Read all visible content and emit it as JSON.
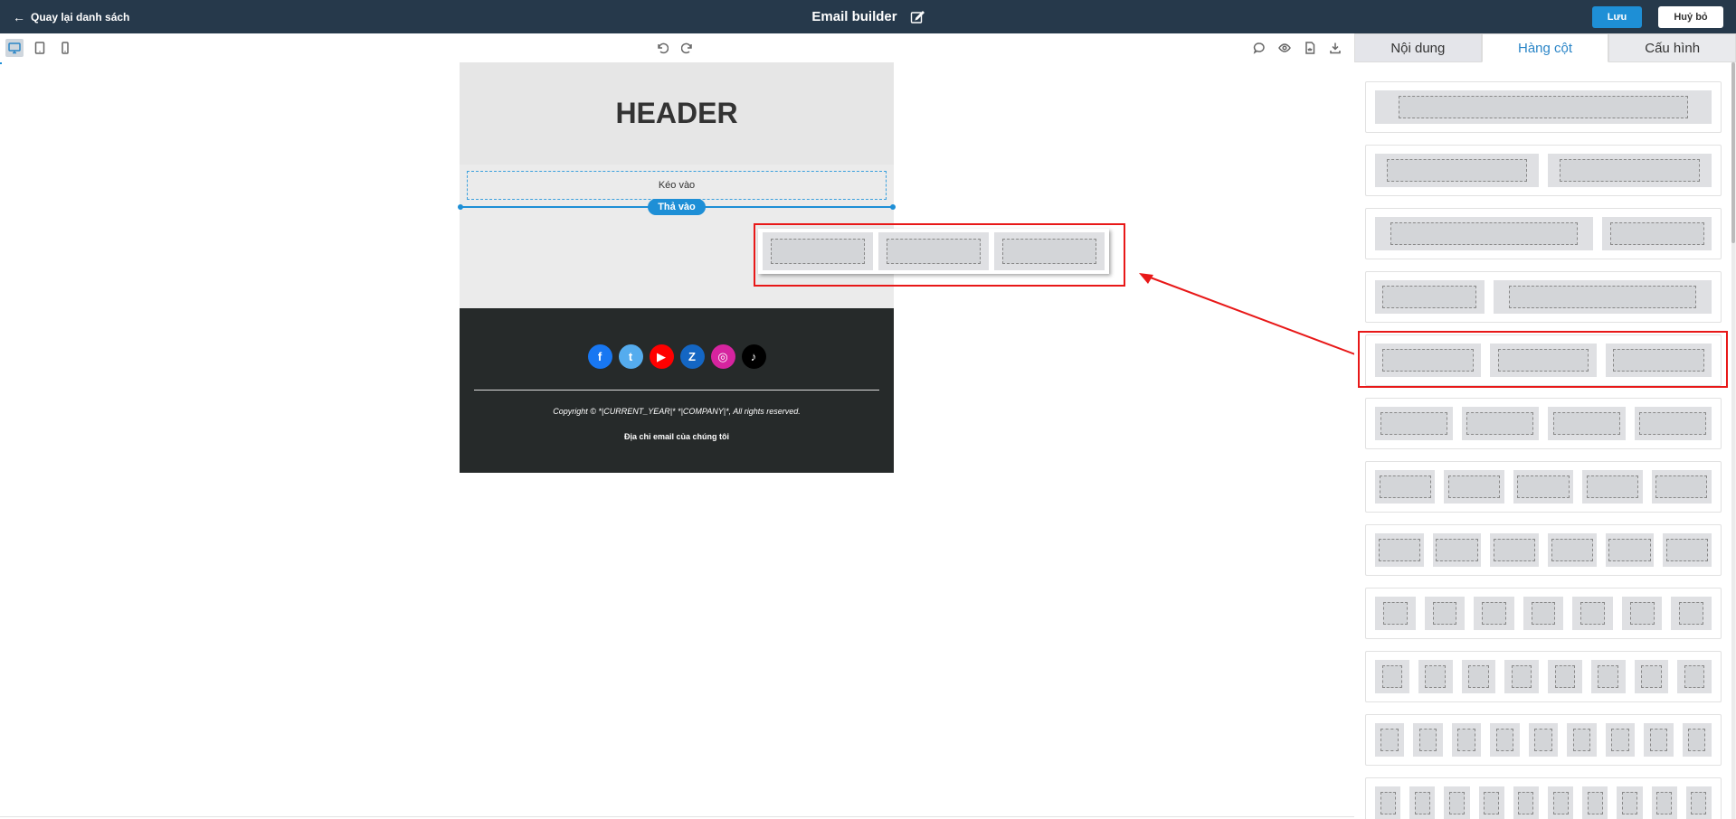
{
  "topbar": {
    "back_label": "Quay lại danh sách",
    "title": "Email builder",
    "save_label": "Lưu",
    "cancel_label": "Huỷ bỏ"
  },
  "toolbar": {
    "view_modes": [
      "desktop-icon",
      "tablet-icon",
      "mobile-icon"
    ],
    "active_view": "desktop",
    "history": [
      "undo-icon",
      "redo-icon"
    ],
    "actions": [
      "comment-icon",
      "preview-eye-icon",
      "html-file-icon",
      "download-icon"
    ]
  },
  "email": {
    "header_text": "HEADER",
    "drag_text": "Kéo vào",
    "drop_text": "Thả vào",
    "socials": [
      {
        "name": "facebook",
        "glyph": "f",
        "color": "#1877f2"
      },
      {
        "name": "twitter",
        "glyph": "t",
        "color": "#55acee"
      },
      {
        "name": "youtube",
        "glyph": "▶",
        "color": "#ff0000"
      },
      {
        "name": "zalo",
        "glyph": "Z",
        "color": "#1466c3"
      },
      {
        "name": "instagram",
        "glyph": "◎",
        "color": "#d6249f"
      },
      {
        "name": "tiktok",
        "glyph": "♪",
        "color": "#000000"
      }
    ],
    "copyright": "Copyright © *|CURRENT_YEAR|* *|COMPANY|*, All rights reserved.",
    "address": "Địa chỉ email của chúng tôi"
  },
  "panel": {
    "tabs": [
      "Nội dung",
      "Hàng cột",
      "Cấu hình"
    ],
    "active_tab": 1,
    "layouts": [
      [
        1
      ],
      [
        1,
        1
      ],
      [
        2,
        1
      ],
      [
        1,
        2
      ],
      [
        1,
        1,
        1
      ],
      [
        1,
        1,
        1,
        1
      ],
      [
        1,
        1,
        1,
        1,
        1
      ],
      [
        1,
        1,
        1,
        1,
        1,
        1
      ],
      [
        1,
        1,
        1,
        1,
        1,
        1,
        1
      ],
      [
        1,
        1,
        1,
        1,
        1,
        1,
        1,
        1
      ],
      [
        1,
        1,
        1,
        1,
        1,
        1,
        1,
        1,
        1
      ],
      [
        1,
        1,
        1,
        1,
        1,
        1,
        1,
        1,
        1,
        1
      ]
    ],
    "highlighted_layout": 4
  },
  "annotation": {
    "color": "#e81818"
  }
}
